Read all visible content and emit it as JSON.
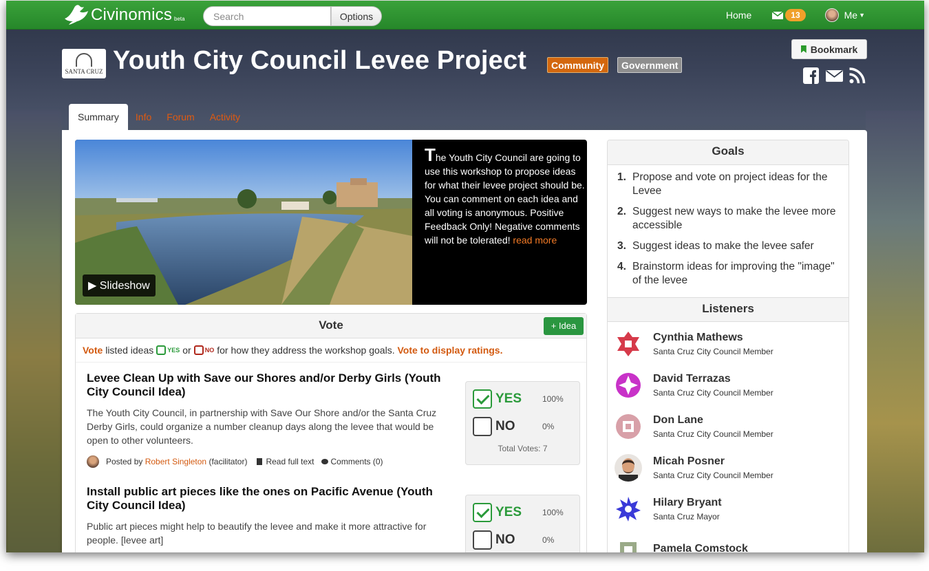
{
  "navbar": {
    "logo_text": "Civinomics",
    "logo_beta": "beta",
    "search_placeholder": "Search",
    "options_label": "Options",
    "home_label": "Home",
    "message_count": "13",
    "me_label": "Me"
  },
  "header": {
    "org_logo_text": "SANTA CRUZ",
    "title": "Youth City Council Levee Project",
    "tags": [
      "Community",
      "Government"
    ],
    "bookmark_label": "Bookmark",
    "share_icons": [
      "facebook-icon",
      "email-icon",
      "rss-icon"
    ]
  },
  "tabs": [
    "Summary",
    "Info",
    "Forum",
    "Activity"
  ],
  "hero": {
    "slideshow_label": "Slideshow",
    "dropcap": "T",
    "text": "he Youth City Council are going to use this workshop to propose ideas for what their levee project should be. You can comment on each idea and all voting is anonymous. Positive Feedback Only! Negative comments will not be tolerated!",
    "read_more": "read more"
  },
  "vote": {
    "heading": "Vote",
    "add_idea_label": "+ Idea",
    "instr_vote": "Vote",
    "instr_listed": "listed ideas",
    "instr_yes": "YES",
    "instr_or": "or",
    "instr_no": "NO",
    "instr_rest": "for how they address the workshop goals.",
    "instr_ratings": "Vote to display ratings.",
    "yes_label": "YES",
    "no_label": "NO",
    "ideas": [
      {
        "title": "Levee Clean Up with Save our Shores and/or Derby Girls (Youth City Council Idea)",
        "description": "The Youth City Council, in partnership with Save Our Shore and/or the Santa Cruz Derby Girls, could organize a number cleanup days along the levee that would be open to other volunteers.",
        "posted_by_label": "Posted by",
        "author": "Robert Singleton",
        "author_role": "(facilitator)",
        "read_full_label": "Read full text",
        "comments_label": "Comments (0)",
        "yes_pct": "100%",
        "no_pct": "0%",
        "total_votes": "Total Votes: 7"
      },
      {
        "title": "Install public art pieces like the ones on Pacific Avenue (Youth City Council Idea)",
        "description": "Public art pieces might help to beautify the levee and make it more attractive for people. [levee art]",
        "yes_pct": "100%",
        "no_pct": "0%"
      }
    ]
  },
  "goals": {
    "heading": "Goals",
    "items": [
      {
        "num": "1.",
        "text": "Propose and vote on project ideas for the Levee"
      },
      {
        "num": "2.",
        "text": "Suggest new ways to make the levee more accessible"
      },
      {
        "num": "3.",
        "text": "Suggest ideas to make the levee safer"
      },
      {
        "num": "4.",
        "text": "Brainstorm ideas for improving the \"image\" of the levee"
      }
    ]
  },
  "listeners": {
    "heading": "Listeners",
    "items": [
      {
        "name": "Cynthia Mathews",
        "role": "Santa Cruz City Council Member",
        "color": "#d63a4a"
      },
      {
        "name": "David Terrazas",
        "role": "Santa Cruz City Council Member",
        "color": "#c832c8"
      },
      {
        "name": "Don Lane",
        "role": "Santa Cruz City Council Member",
        "color": "#d8a0a8"
      },
      {
        "name": "Micah Posner",
        "role": "Santa Cruz City Council Member",
        "color": "#7a5a48"
      },
      {
        "name": "Hilary Bryant",
        "role": "Santa Cruz Mayor",
        "color": "#3a3ad8"
      },
      {
        "name": "Pamela Comstock",
        "role": "",
        "color": "#9aaa88"
      }
    ]
  },
  "colors": {
    "navbar_green": "#2a922e",
    "accent_orange": "#d3670e",
    "yes_green": "#2a9a3a",
    "no_red": "#b0281c"
  }
}
